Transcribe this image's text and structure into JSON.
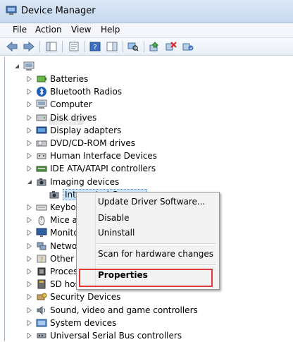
{
  "window": {
    "title": "Device Manager"
  },
  "menu": [
    "File",
    "Action",
    "View",
    "Help"
  ],
  "toolbar_icons": [
    "back-arrow-icon",
    "forward-arrow-icon",
    "show-hide-tree-icon",
    "properties-icon",
    "help-icon",
    "action-pane-icon",
    "scan-hardware-icon",
    "update-driver-icon",
    "uninstall-icon",
    "enable-device-icon"
  ],
  "tree": {
    "items": [
      {
        "label": "Batteries",
        "icon": "battery-icon"
      },
      {
        "label": "Bluetooth Radios",
        "icon": "bluetooth-icon"
      },
      {
        "label": "Computer",
        "icon": "computer-icon"
      },
      {
        "label": "Disk drives",
        "icon": "disk-drive-icon"
      },
      {
        "label": "Display adapters",
        "icon": "display-adapter-icon"
      },
      {
        "label": "DVD/CD-ROM drives",
        "icon": "dvd-icon"
      },
      {
        "label": "Human Interface Devices",
        "icon": "hid-icon"
      },
      {
        "label": "IDE ATA/ATAPI controllers",
        "icon": "ide-controller-icon"
      },
      {
        "label": "Imaging devices",
        "icon": "camera-icon"
      },
      {
        "label": "Integrated Camera",
        "icon": "camera-icon"
      },
      {
        "label": "Keyboards",
        "icon": "keyboard-icon"
      },
      {
        "label": "Mice and other pointing devices",
        "icon": "mouse-icon"
      },
      {
        "label": "Monitors",
        "icon": "monitor-icon"
      },
      {
        "label": "Network adapters",
        "icon": "network-icon"
      },
      {
        "label": "Other devices",
        "icon": "other-devices-icon"
      },
      {
        "label": "Processors",
        "icon": "processor-icon"
      },
      {
        "label": "SD host adapters",
        "icon": "sd-host-icon"
      },
      {
        "label": "Security Devices",
        "icon": "security-icon"
      },
      {
        "label": "Sound, video and game controllers",
        "icon": "sound-icon"
      },
      {
        "label": "System devices",
        "icon": "system-devices-icon"
      },
      {
        "label": "Universal Serial Bus controllers",
        "icon": "usb-icon"
      }
    ]
  },
  "context_menu": {
    "update": "Update Driver Software...",
    "disable": "Disable",
    "uninstall": "Uninstall",
    "scan": "Scan for hardware changes",
    "properties": "Properties"
  }
}
